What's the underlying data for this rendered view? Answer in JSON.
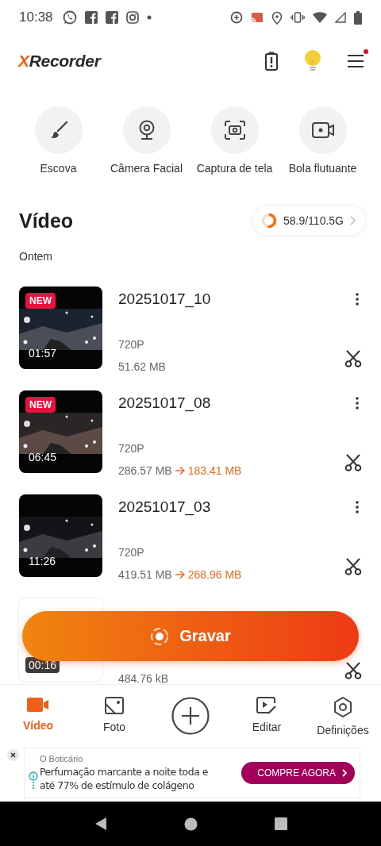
{
  "status_bar": {
    "time": "10:38"
  },
  "header": {
    "logo_mark": "X",
    "logo_text": "Recorder",
    "menu_badge": true
  },
  "tools": [
    {
      "kind": "brush",
      "label": "Escova"
    },
    {
      "kind": "webcam",
      "label": "Câmera Facial"
    },
    {
      "kind": "screenshot",
      "label": "Captura de tela"
    },
    {
      "kind": "float",
      "label": "Bola flutuante"
    }
  ],
  "section": {
    "title": "Vídeo",
    "storage": {
      "text": "58.9/110.5G",
      "level": 0.53
    }
  },
  "group_label": "Ontem",
  "videos": [
    {
      "badge": "NEW",
      "duration": "01:57",
      "title": "20251017_10",
      "resolution": "720P",
      "size": "51.62 MB"
    },
    {
      "badge": "NEW",
      "duration": "06:45",
      "title": "20251017_08",
      "resolution": "720P",
      "size": "286.57 MB",
      "compressed_size": "183.41 MB"
    },
    {
      "duration": "11:26",
      "title": "20251017_03",
      "resolution": "720P",
      "size": "419.51 MB",
      "compressed_size": "268.96 MB"
    },
    {
      "thumbnail": {
        "kind": "blank"
      },
      "duration": "00:16",
      "size": "484.76 kB"
    }
  ],
  "record_button": "Gravar",
  "nav": [
    {
      "kind": "video",
      "label": "Vídeo",
      "selected": true
    },
    {
      "label": "Foto",
      "selected": false
    },
    {
      "kind": "add",
      "selected": false
    },
    {
      "kind": "edit",
      "label": "Editar",
      "selected": false
    },
    {
      "kind": "settings",
      "label": "Definições",
      "selected": false
    }
  ],
  "ad": {
    "advertiser": "O Boticário",
    "text": "Perfumação marcante a noite toda e até 77% de estímulo de colágeno",
    "cta": "COMPRE AGORA"
  }
}
